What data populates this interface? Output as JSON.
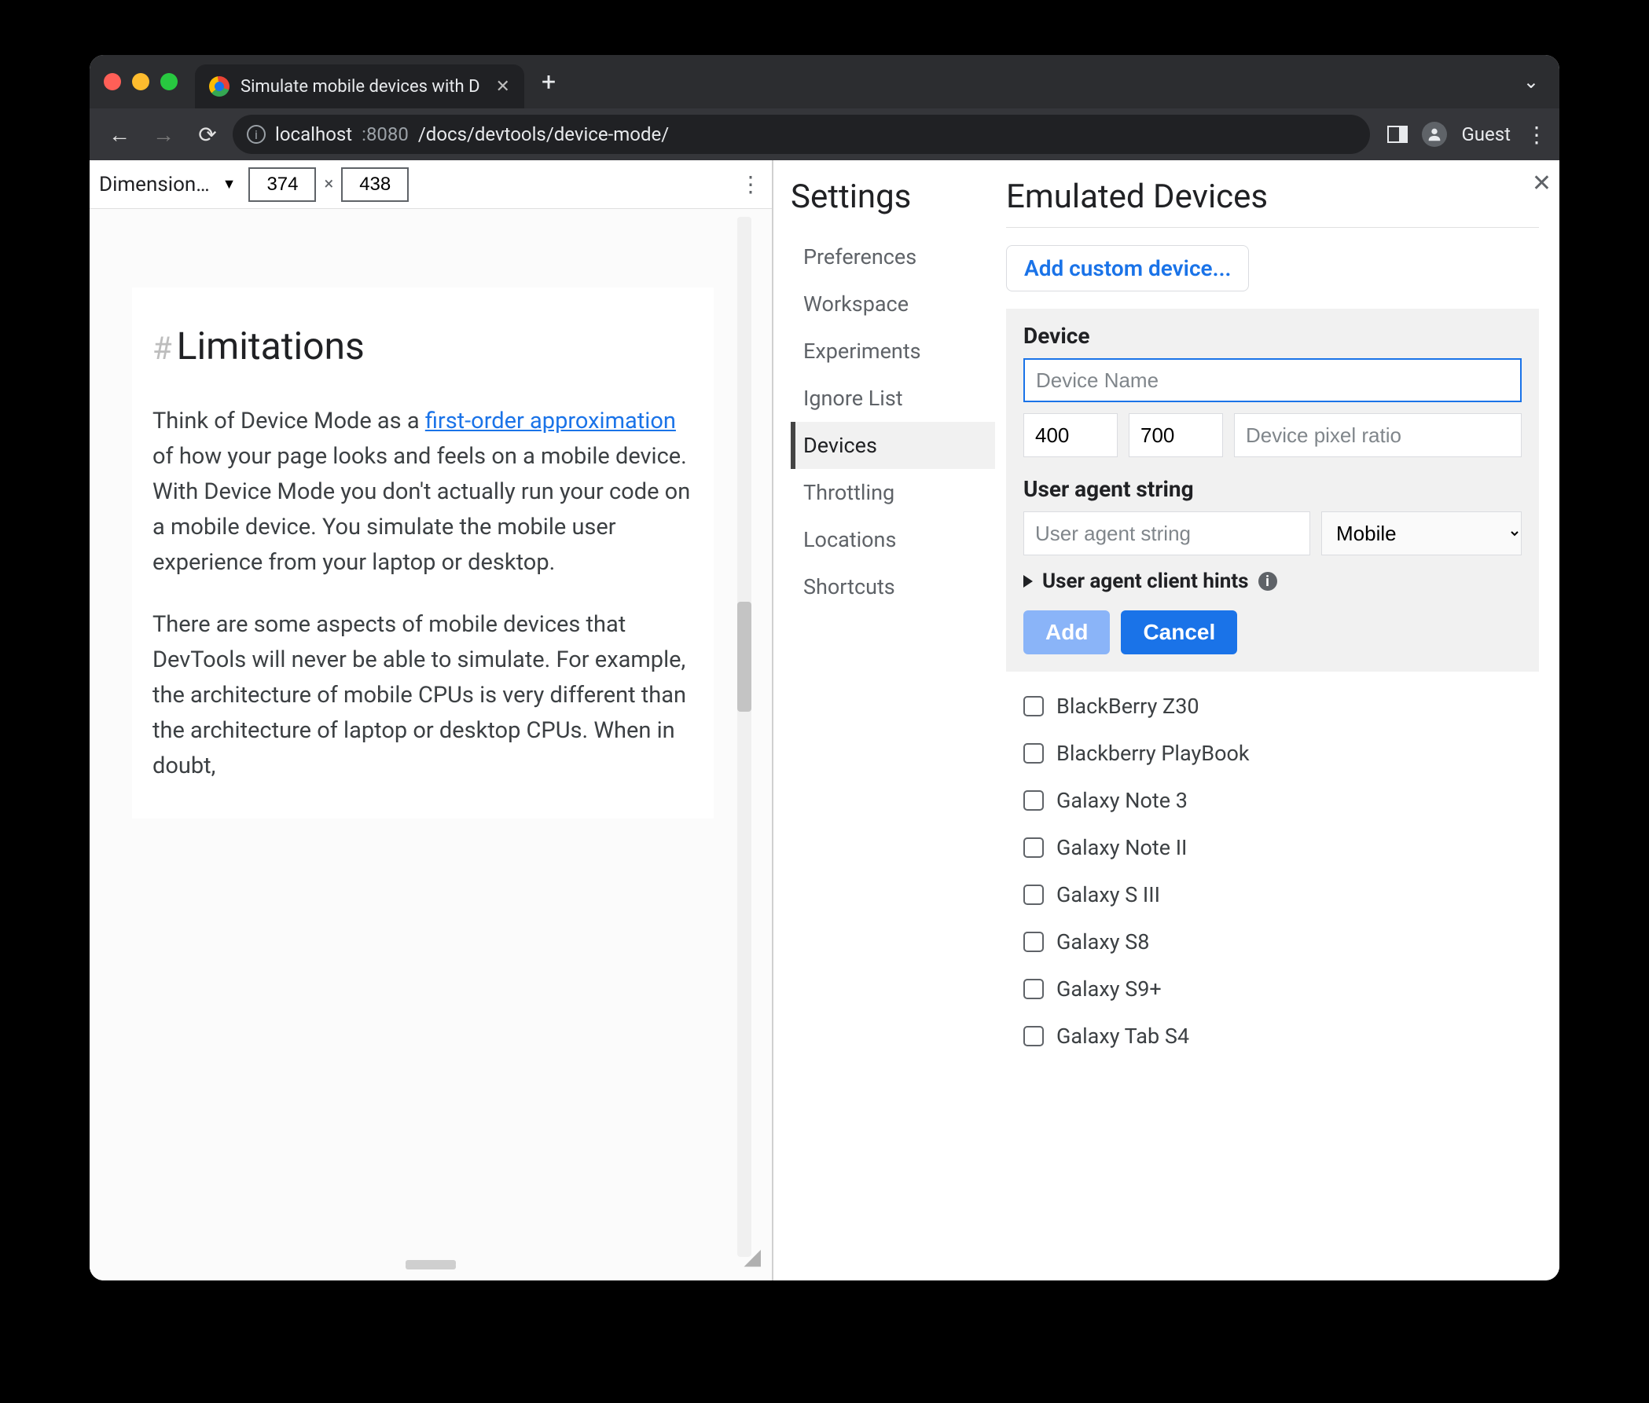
{
  "tab": {
    "title": "Simulate mobile devices with D"
  },
  "omnibox": {
    "host": "localhost",
    "port": ":8080",
    "path": "/docs/devtools/device-mode/"
  },
  "guest_label": "Guest",
  "device_toolbar": {
    "dimensions_label": "Dimension…",
    "width": "374",
    "height": "438",
    "separator": "×"
  },
  "page_content": {
    "heading": "Limitations",
    "p1_prefix": "Think of Device Mode as a ",
    "p1_link": "first-order approximation",
    "p1_suffix": " of how your page looks and feels on a mobile device. With Device Mode you don't actually run your code on a mobile device. You simulate the mobile user experience from your laptop or desktop.",
    "p2": "There are some aspects of mobile devices that DevTools will never be able to simulate. For example, the architecture of mobile CPUs is very different than the architecture of laptop or desktop CPUs. When in doubt,"
  },
  "settings": {
    "title": "Settings",
    "items": [
      "Preferences",
      "Workspace",
      "Experiments",
      "Ignore List",
      "Devices",
      "Throttling",
      "Locations",
      "Shortcuts"
    ],
    "active_index": 4
  },
  "emulated": {
    "title": "Emulated Devices",
    "add_custom_label": "Add custom device...",
    "device_section_label": "Device",
    "device_name_placeholder": "Device Name",
    "width_value": "400",
    "height_value": "700",
    "dpr_placeholder": "Device pixel ratio",
    "ua_section_label": "User agent string",
    "ua_placeholder": "User agent string",
    "ua_type_selected": "Mobile",
    "hints_label": "User agent client hints",
    "add_btn": "Add",
    "cancel_btn": "Cancel",
    "devices": [
      "BlackBerry Z30",
      "Blackberry PlayBook",
      "Galaxy Note 3",
      "Galaxy Note II",
      "Galaxy S III",
      "Galaxy S8",
      "Galaxy S9+",
      "Galaxy Tab S4"
    ]
  }
}
